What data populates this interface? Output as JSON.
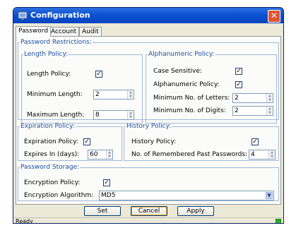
{
  "window": {
    "title": "Configuration"
  },
  "tabs": [
    {
      "label": "Password"
    },
    {
      "label": "Account"
    },
    {
      "label": "Audit"
    }
  ],
  "password_restrictions": {
    "legend": "Password Restrictions:",
    "length_policy": {
      "legend": "Length Policy:",
      "enabled_label": "Length Policy:",
      "enabled": true,
      "min_label": "Minimum Length:",
      "min_value": "2",
      "max_label": "Maximum Length:",
      "max_value": "8"
    },
    "alphanumeric_policy": {
      "legend": "Alphanumeric Policy:",
      "case_label": "Case Sensitive:",
      "case_checked": true,
      "alnum_label": "Alphanumeric Policy:",
      "alnum_checked": true,
      "letters_label": "Minimum No. of Letters:",
      "letters_value": "2",
      "digits_label": "Minimum No. of Digits:",
      "digits_value": "2"
    }
  },
  "expiration_policy": {
    "legend": "Expiration Policy:",
    "enabled_label": "Expiration Policy:",
    "enabled": true,
    "days_label": "Expires In (days):",
    "days_value": "60"
  },
  "history_policy": {
    "legend": "History Policy:",
    "enabled_label": "History Policy:",
    "enabled": true,
    "remembered_label": "No. of Remembered Past Passwords:",
    "remembered_value": "4"
  },
  "password_storage": {
    "legend": "Password Storage:",
    "encryption_label": "Encryption Policy:",
    "encryption_checked": true,
    "algorithm_label": "Encryption Algorithm:",
    "algorithm_value": "MD5"
  },
  "buttons": {
    "set": "Set",
    "cancel": "Cancel",
    "apply": "Apply"
  },
  "status": {
    "text": "Ready"
  },
  "glyphs": {
    "check": "✓",
    "up": "▲",
    "down": "▼",
    "close": "✕",
    "dropdown": "▼"
  },
  "colors": {
    "title_bar": "#0a4fd0",
    "legend_text": "#1c4ea0",
    "status_led": "#27b024"
  }
}
